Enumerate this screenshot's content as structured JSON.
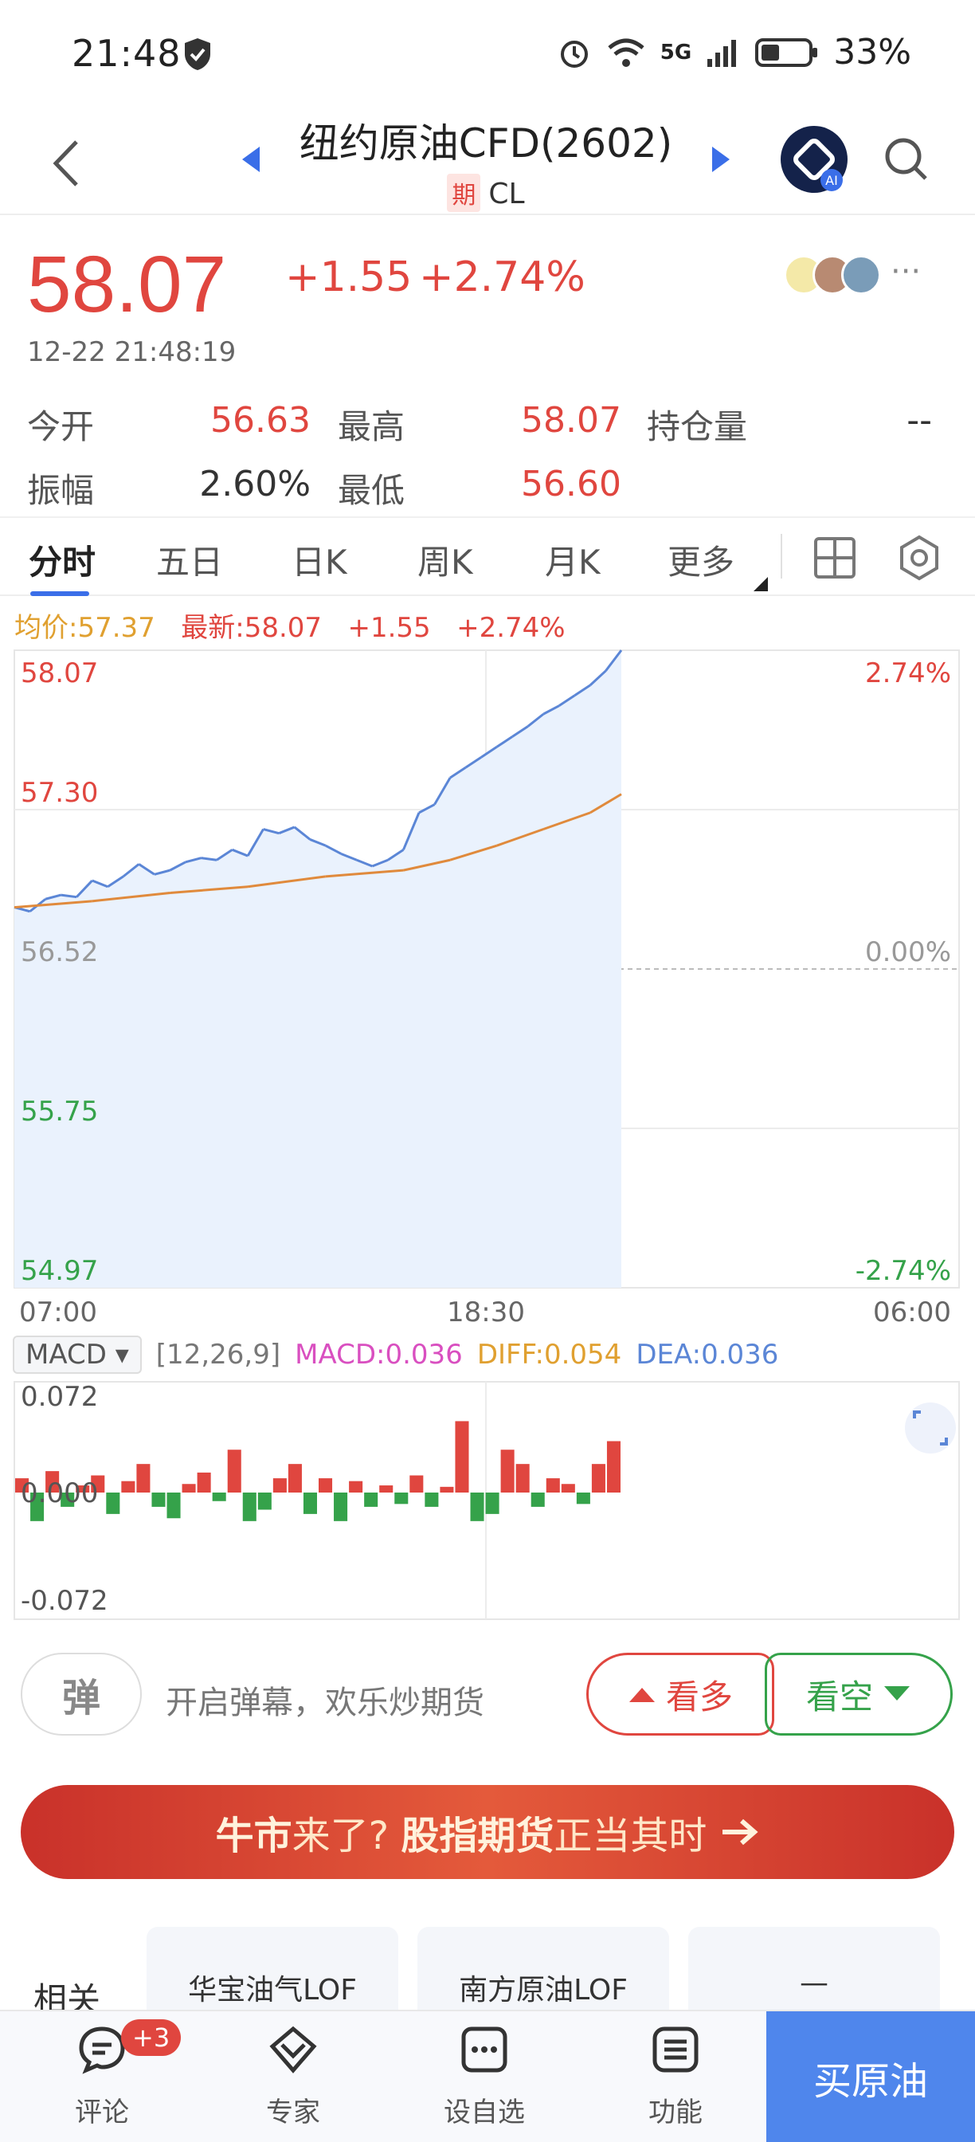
{
  "status": {
    "time": "21:48",
    "battery": "33%",
    "network": "5G"
  },
  "header": {
    "title": "纽约原油CFD(2602)",
    "badge": "期",
    "code": "CL",
    "ai_label": "AI"
  },
  "quote": {
    "price": "58.07",
    "change": "+1.55",
    "change_pct": "+2.74%",
    "time": "12-22 21:48:19",
    "stats": [
      {
        "label": "今开",
        "value": "56.63"
      },
      {
        "label": "最高",
        "value": "58.07"
      },
      {
        "label": "持仓量",
        "value": "--"
      },
      {
        "label": "振幅",
        "value": "2.60%"
      },
      {
        "label": "最低",
        "value": "56.60"
      }
    ]
  },
  "tabs": [
    "分时",
    "五日",
    "日K",
    "周K",
    "月K",
    "更多"
  ],
  "chart_legend": {
    "avg": "均价:57.37",
    "latest": "最新:58.07",
    "change": "+1.55",
    "pct": "+2.74%"
  },
  "chart_data": [
    {
      "type": "line",
      "title": "",
      "x_ticks": [
        "07:00",
        "18:30",
        "06:00"
      ],
      "y_ticks_left": [
        "58.07",
        "57.30",
        "56.52",
        "55.75",
        "54.97"
      ],
      "y_ticks_right": [
        "2.74%",
        "",
        "0.00%",
        "",
        "-2.74%"
      ],
      "ylim": [
        54.97,
        58.07
      ],
      "series": [
        {
          "color": "#5b86d6",
          "x": [
            0,
            20,
            40,
            60,
            80,
            100,
            120,
            140,
            160,
            180,
            200,
            220,
            240,
            260,
            280,
            300,
            320,
            340,
            360,
            380,
            400,
            420,
            440,
            460,
            480,
            500,
            520,
            540,
            560,
            580,
            600,
            620,
            640,
            660,
            680,
            700,
            720,
            740,
            760,
            780
          ],
          "values": [
            56.82,
            56.8,
            56.86,
            56.88,
            56.87,
            56.95,
            56.92,
            56.97,
            57.03,
            56.98,
            57.0,
            57.04,
            57.06,
            57.05,
            57.1,
            57.07,
            57.2,
            57.18,
            57.21,
            57.15,
            57.12,
            57.08,
            57.05,
            57.02,
            57.05,
            57.1,
            57.28,
            57.32,
            57.45,
            57.5,
            57.55,
            57.6,
            57.65,
            57.7,
            57.76,
            57.8,
            57.85,
            57.9,
            57.97,
            58.07
          ]
        },
        {
          "color": "#e08a3c",
          "x": [
            0,
            100,
            200,
            300,
            400,
            500,
            560,
            620,
            680,
            740,
            780
          ],
          "values": [
            56.82,
            56.85,
            56.89,
            56.92,
            56.97,
            57.0,
            57.05,
            57.12,
            57.2,
            57.28,
            57.37
          ]
        }
      ]
    },
    {
      "type": "bar",
      "title": "",
      "y_ticks": [
        "0.072",
        "0.000",
        "-0.072"
      ],
      "ylim": [
        -0.072,
        0.072
      ],
      "legend": {
        "select": "MACD",
        "params": "[12,26,9]",
        "macd": "MACD:0.036",
        "diff": "DIFF:0.054",
        "dea": "DEA:0.036"
      },
      "values": [
        0.01,
        -0.02,
        0.015,
        -0.01,
        0.005,
        0.012,
        -0.015,
        0.008,
        0.02,
        -0.01,
        -0.018,
        0.006,
        0.014,
        -0.006,
        0.03,
        -0.02,
        -0.012,
        0.01,
        0.02,
        -0.015,
        0.01,
        -0.02,
        0.008,
        -0.01,
        0.005,
        -0.008,
        0.012,
        -0.01,
        0.004,
        0.05,
        -0.02,
        -0.015,
        0.03,
        0.02,
        -0.01,
        0.01,
        0.006,
        -0.008,
        0.02,
        0.036
      ]
    }
  ],
  "danmu": {
    "btn": "弹",
    "text": "开启弹幕，欢乐炒期货"
  },
  "vote": {
    "bull": "看多",
    "bear": "看空"
  },
  "banner": {
    "part1": "牛市",
    "part2": "来了?",
    "part3": "股指期货",
    "part4": "正当其时"
  },
  "related": {
    "label": "相关",
    "cards": [
      "华宝油气LOF",
      "南方原油LOF",
      "—"
    ]
  },
  "bottom_nav": {
    "comment": "评论",
    "badge": "+3",
    "expert": "专家",
    "watch": "设自选",
    "func": "功能",
    "buy": "买原油"
  }
}
